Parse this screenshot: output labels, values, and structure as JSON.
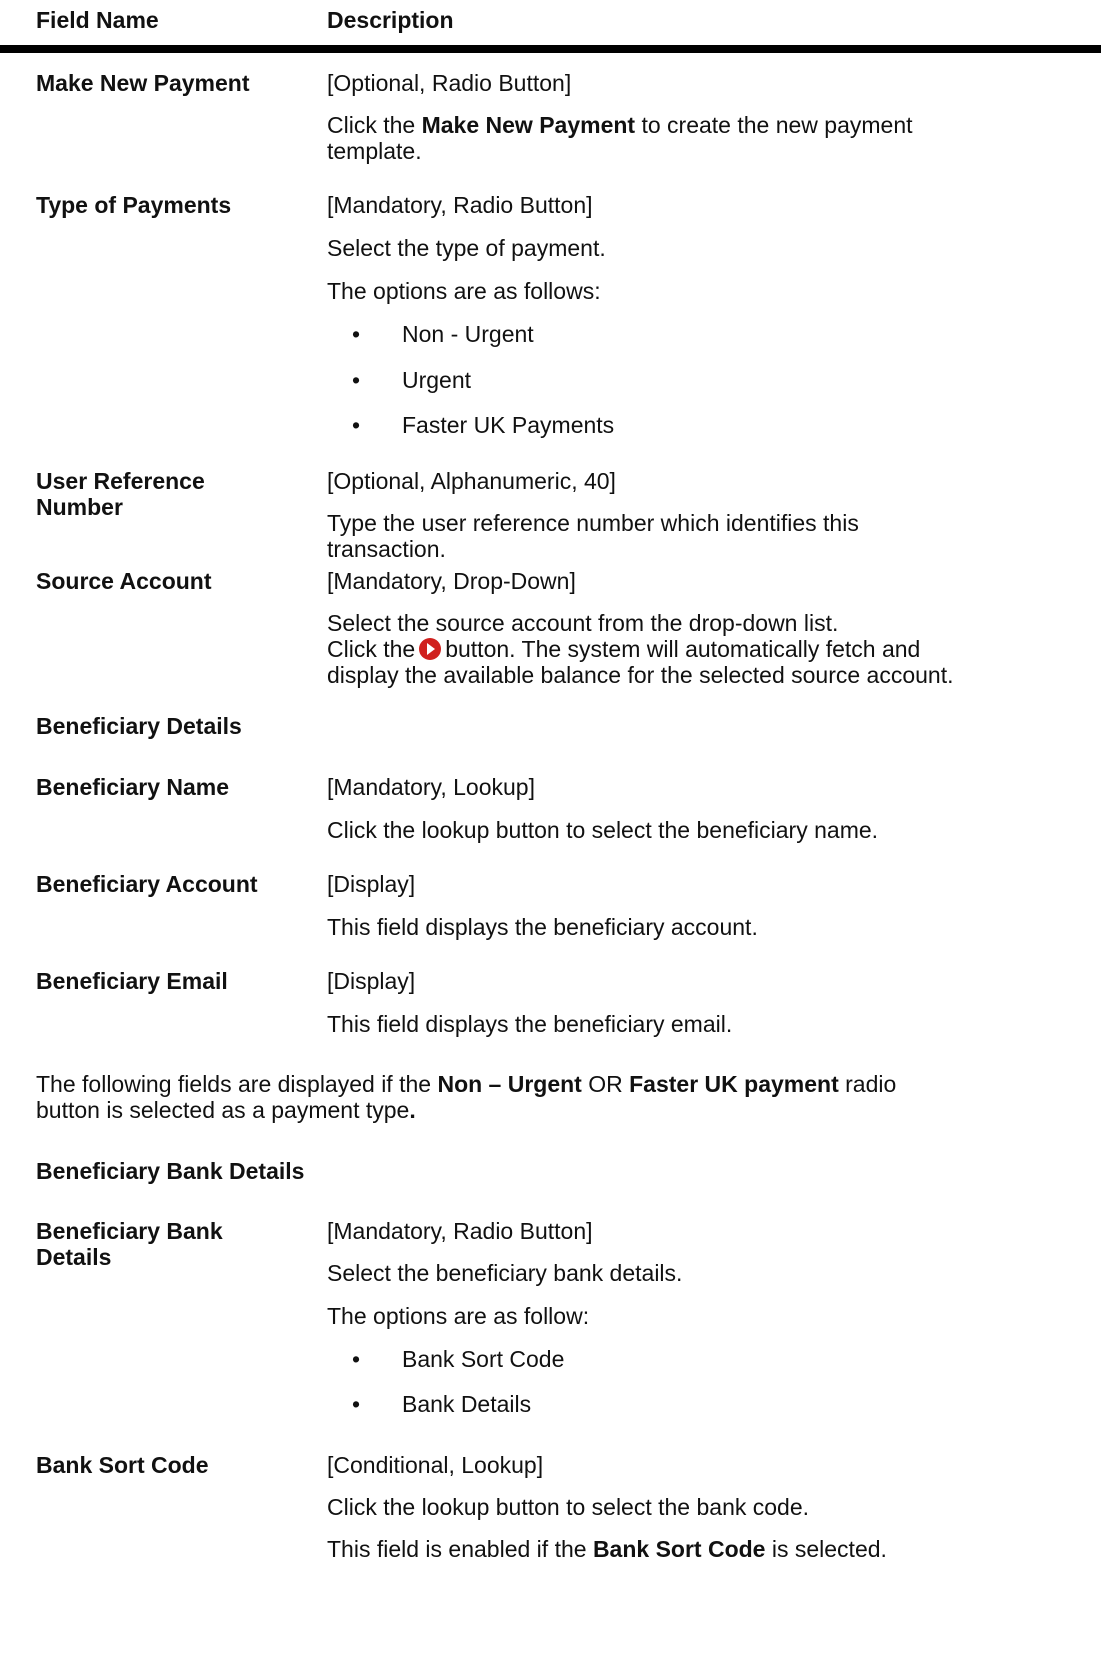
{
  "table_header": {
    "field_name": "Field Name",
    "description": "Description"
  },
  "rows": {
    "make_new_payment": {
      "label": "Make New Payment",
      "spec": "[Optional, Radio Button]",
      "desc_pre": "Click the ",
      "desc_bold": "Make New Payment",
      "desc_post": " to create the new payment",
      "desc_line2": "template."
    },
    "type_of_payments": {
      "label": "Type of Payments",
      "spec": "[Mandatory, Radio Button]",
      "desc": "Select the type of payment.",
      "options_intro": "The options are as follows:",
      "options": [
        "Non - Urgent",
        "Urgent",
        "Faster UK Payments"
      ]
    },
    "user_reference_number": {
      "label_line1": "User Reference",
      "label_line2": "Number",
      "spec": "[Optional, Alphanumeric, 40]",
      "desc_line1": "Type the user reference number which identifies this",
      "desc_line2": "transaction."
    },
    "source_account": {
      "label": "Source Account",
      "spec": "[Mandatory, Drop-Down]",
      "desc_line1": "Select the source account from the drop-down list.",
      "desc_line2_pre": "Click the",
      "desc_line2_post": "button. The system will automatically fetch and",
      "desc_line3": "display the available balance for the selected source account."
    },
    "beneficiary_details_heading": "Beneficiary Details",
    "beneficiary_name": {
      "label": "Beneficiary Name",
      "spec": "[Mandatory, Lookup]",
      "desc": "Click the lookup button to select the beneficiary name."
    },
    "beneficiary_account": {
      "label": "Beneficiary Account",
      "spec": "[Display]",
      "desc": "This field displays the beneficiary account."
    },
    "beneficiary_email": {
      "label": "Beneficiary Email",
      "spec": "[Display]",
      "desc": "This field displays the beneficiary email."
    }
  },
  "note": {
    "pre": "The following fields are displayed if the ",
    "bold1": "Non – Urgent",
    "mid": " OR ",
    "bold2": "Faster UK payment",
    "post": " radio",
    "line2": "button is selected as a payment type",
    "line2_end": "."
  },
  "bank_section_heading": "Beneficiary Bank Details",
  "bank_rows": {
    "beneficiary_bank_details": {
      "label_line1": "Beneficiary Bank",
      "label_line2": "Details",
      "spec": "[Mandatory, Radio Button]",
      "desc": "Select the beneficiary bank details.",
      "options_intro": "The options are as follow:",
      "options": [
        "Bank Sort Code",
        "Bank Details"
      ]
    },
    "bank_sort_code": {
      "label": "Bank Sort Code",
      "spec": "[Conditional, Lookup]",
      "desc": "Click the lookup button to select the bank code.",
      "cond_pre": "This field is enabled if the ",
      "cond_bold": "Bank Sort Code",
      "cond_post": " is selected."
    }
  }
}
